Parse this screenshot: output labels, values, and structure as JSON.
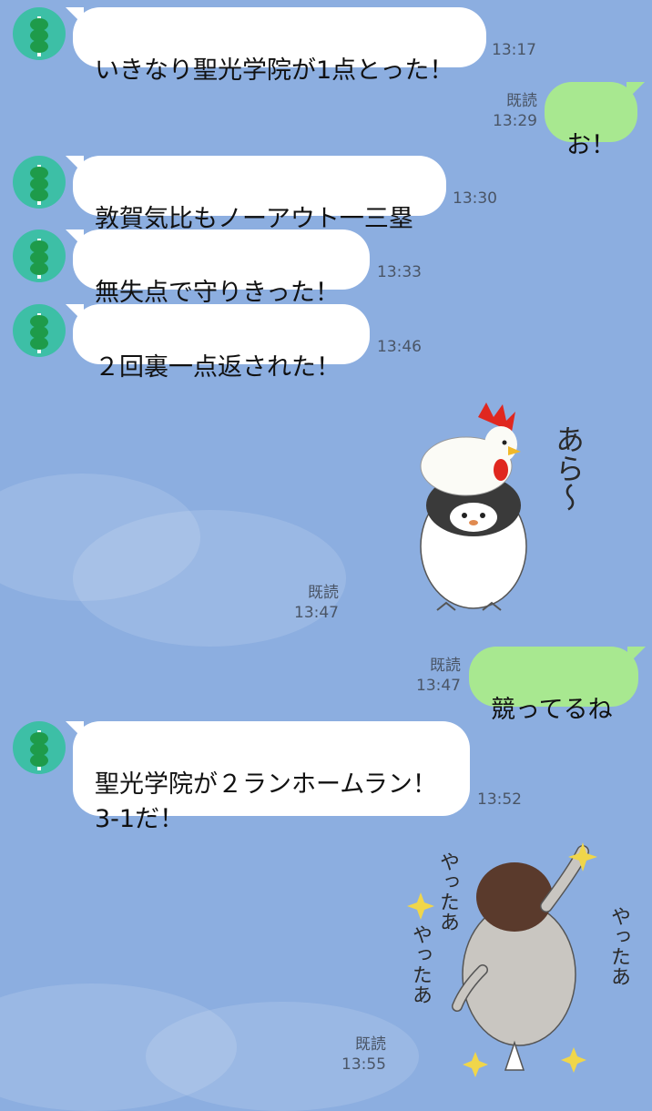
{
  "colors": {
    "background": "#8caee0",
    "bubble_received": "#ffffff",
    "bubble_sent": "#a8e890",
    "avatar": "#3dbfa6"
  },
  "messages": [
    {
      "from": "them",
      "text": "いきなり聖光学院が1点とった！",
      "time": "13:17"
    },
    {
      "from": "me",
      "text": "お！",
      "read": "既読",
      "time": "13:29"
    },
    {
      "from": "them",
      "text": "敦賀気比もノーアウト一三塁",
      "time": "13:30"
    },
    {
      "from": "them",
      "text": "無失点で守りきった！",
      "time": "13:33"
    },
    {
      "from": "them",
      "text": "２回裏一点返された！",
      "time": "13:46"
    },
    {
      "from": "me",
      "type": "sticker",
      "sticker_icon": "penguin-rooster-sticker",
      "sticker_text": "あら～",
      "read": "既読",
      "time": "13:47"
    },
    {
      "from": "me",
      "text": "競ってるね",
      "read": "既読",
      "time": "13:47"
    },
    {
      "from": "them",
      "text": "聖光学院が２ランホームラン！\n3-1だ！",
      "time": "13:52"
    },
    {
      "from": "me",
      "type": "sticker",
      "sticker_icon": "penguin-cheer-sticker",
      "sticker_text": [
        "やったあ",
        "やったあ",
        "やったあ"
      ],
      "read": "既読",
      "time": "13:55"
    }
  ]
}
